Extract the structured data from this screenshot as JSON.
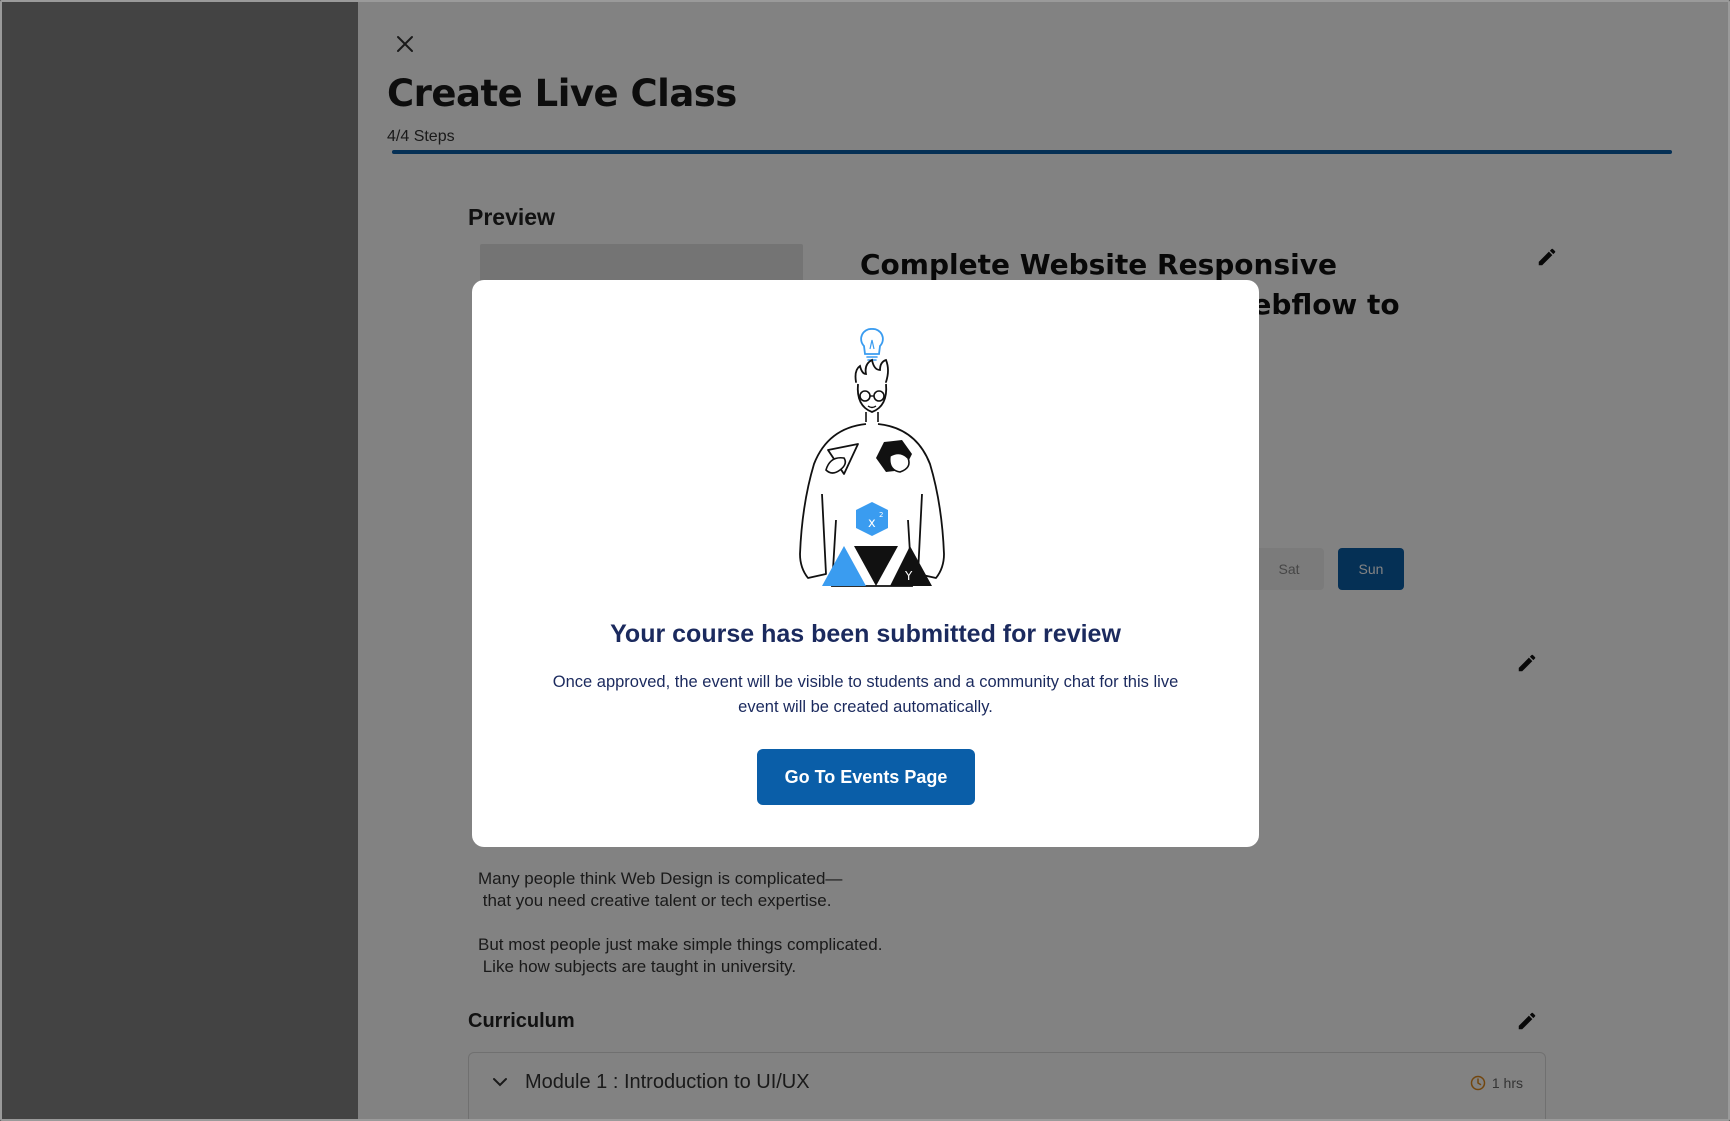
{
  "header": {
    "title": "Create Live Class",
    "steps": "4/4 Steps",
    "progress_fraction": 1.0
  },
  "preview": {
    "section_title": "Preview",
    "course_title": "Complete Website Responsive Design: from Figma to Webflow to Website Design",
    "days": {
      "sat": "Sat",
      "sun": "Sun"
    },
    "description": "Many people think Web Design is complicated—\n that you need creative talent or tech expertise.\n\nBut most people just make simple things complicated.\n Like how subjects are taught in university.",
    "curriculum_title": "Curriculum",
    "module": {
      "title": "Module 1 : Introduction to UI/UX",
      "duration": "1 hrs"
    }
  },
  "modal": {
    "title": "Your course has been submitted for review",
    "message": "Once approved, the event will be visible to students and a community chat for this live event will be created automatically.",
    "button_label": "Go To Events Page"
  },
  "colors": {
    "accent": "#0a5ea8",
    "modal_text": "#1b2a5e",
    "illustration_blue": "#3a9cf0"
  }
}
